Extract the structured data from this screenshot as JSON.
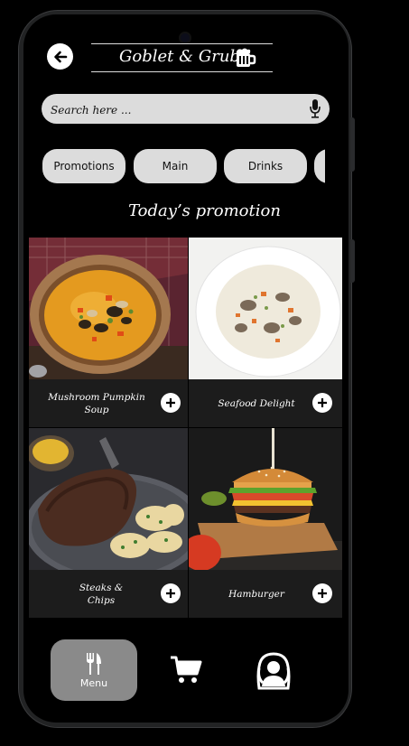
{
  "header": {
    "title": "Goblet & Grub",
    "back_icon": "arrow-left-icon",
    "logo_icon": "beer-mug-icon"
  },
  "search": {
    "placeholder": "Search here ...",
    "mic_icon": "microphone-icon"
  },
  "categories": [
    "Promotions",
    "Main",
    "Drinks",
    ""
  ],
  "section": {
    "title": "Today’s promotion"
  },
  "items": [
    {
      "name": "Mushroom Pumpkin Soup",
      "image": "pumpkin-soup-photo"
    },
    {
      "name": "Seafood Delight",
      "image": "clam-chowder-photo"
    },
    {
      "name": "Steaks & Chips",
      "image": "steak-potatoes-photo"
    },
    {
      "name": "Hamburger",
      "image": "hamburger-photo"
    }
  ],
  "nav": {
    "menu_label": "Menu",
    "menu_icon": "fork-knife-icon",
    "cart_icon": "cart-icon",
    "profile_icon": "profile-icon"
  },
  "colors": {
    "background": "#000000",
    "chip": "#dcdcdc",
    "active_nav": "#8a8a8a",
    "caption": "#1c1c1c"
  }
}
